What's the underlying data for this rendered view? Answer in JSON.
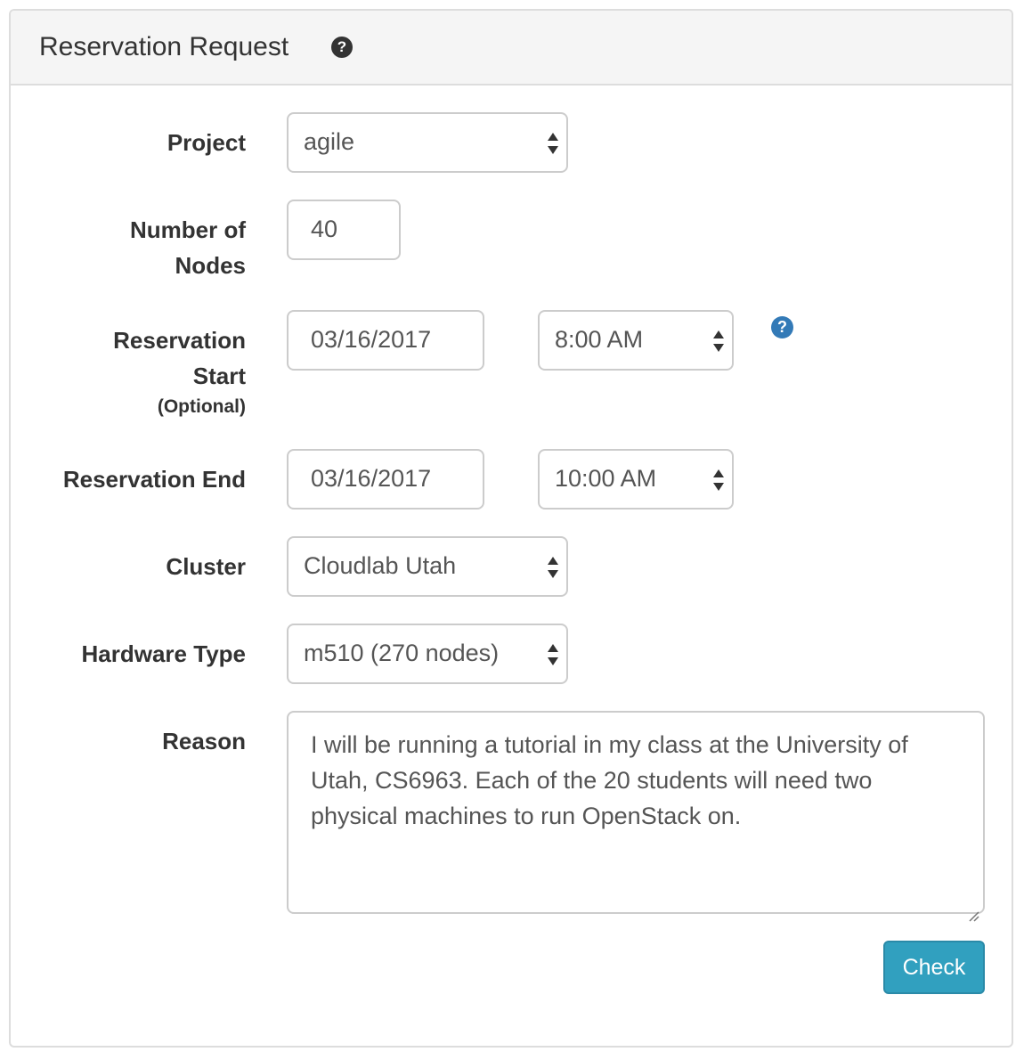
{
  "panel": {
    "title": "Reservation Request",
    "help_glyph": "?"
  },
  "form": {
    "project": {
      "label": "Project",
      "value": "agile"
    },
    "nodes": {
      "label_line1": "Number of",
      "label_line2": "Nodes",
      "value": "40"
    },
    "start": {
      "label_line1": "Reservation",
      "label_line2": "Start",
      "label_optional": "(Optional)",
      "date": "03/16/2017",
      "time": "8:00 AM",
      "help_glyph": "?"
    },
    "end": {
      "label": "Reservation End",
      "date": "03/16/2017",
      "time": "10:00 AM"
    },
    "cluster": {
      "label": "Cluster",
      "value": "Cloudlab Utah"
    },
    "hardware": {
      "label": "Hardware Type",
      "value": "m510 (270 nodes)"
    },
    "reason": {
      "label": "Reason",
      "value": "I will be running a tutorial in my class at the University of Utah, CS6963. Each of the 20 students will need two physical machines to run OpenStack on."
    },
    "check_label": "Check"
  },
  "colors": {
    "accent_button": "#31a0bf",
    "help_icon": "#337ab7",
    "heading_bg": "#f5f5f5",
    "border": "#cccccc"
  },
  "icons": [
    "question-circle-icon",
    "select-arrows-icon",
    "resize-grip-icon"
  ]
}
